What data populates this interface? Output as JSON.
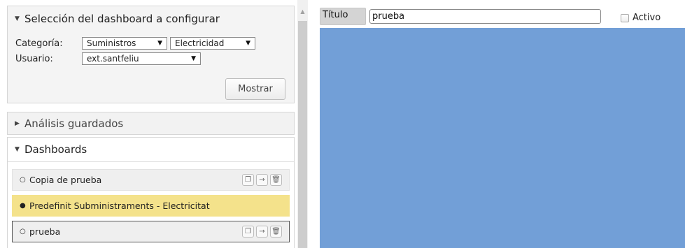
{
  "selection_panel": {
    "title": "Selección del dashboard a configurar",
    "category_label": "Categoría:",
    "category_value": "Suministros",
    "subcategory_value": "Electricidad",
    "user_label": "Usuario:",
    "user_value": "ext.santfeliu",
    "show_button": "Mostrar"
  },
  "saved_analysis_panel": {
    "title": "Análisis guardados"
  },
  "dashboards_panel": {
    "title": "Dashboards",
    "items": [
      {
        "label": "Copia de prueba",
        "selected": false
      },
      {
        "label": "Predefinit Subministraments - Electricitat",
        "selected": true
      },
      {
        "label": "prueba",
        "selected": false
      }
    ]
  },
  "editor": {
    "title_label": "Título",
    "title_value": "prueba",
    "active_label": "Activo",
    "active_checked": false,
    "canvas_color": "#729fd7"
  },
  "colors": {
    "selected_item": "#f4e28b",
    "panel_background": "#f4f4f4"
  }
}
